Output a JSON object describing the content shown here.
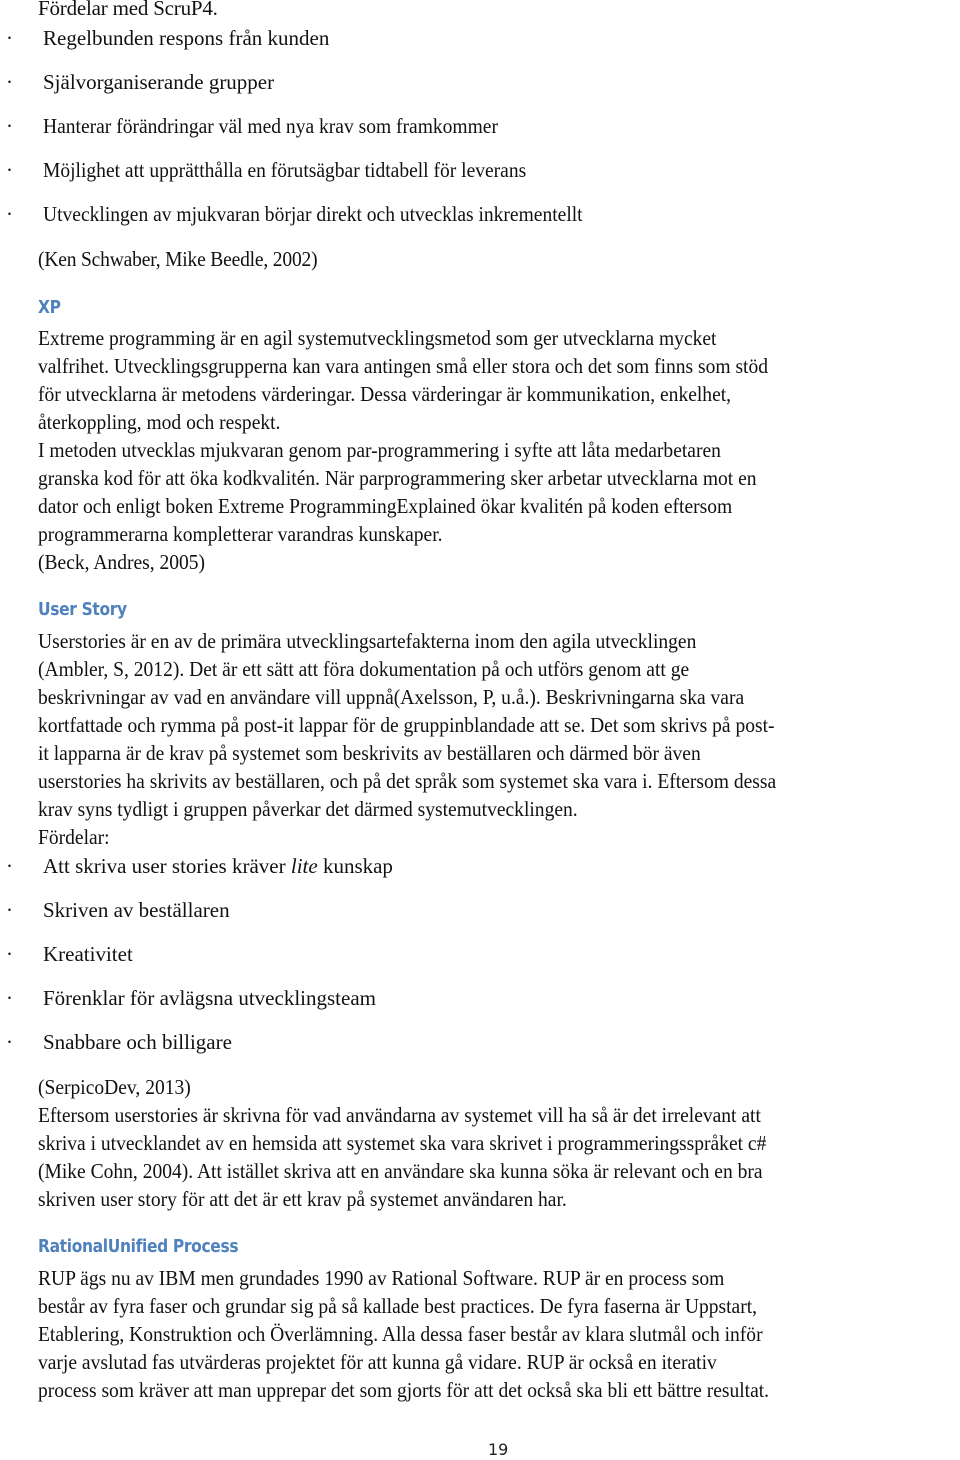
{
  "scrum_advantages": {
    "title": "Fördelar med ScruP4.",
    "bullet": "·",
    "items": [
      "Regelbunden respons från kunden",
      "Självorganiserande grupper",
      "Hanterar förändringar väl med nya krav som framkommer",
      "Möjlighet att upprätthålla en förutsägbar tidtabell för leverans",
      "Utvecklingen av mjukvaran börjar direkt och utvecklas inkrementellt"
    ],
    "citation": "(Ken Schwaber, Mike Beedle, 2002)"
  },
  "xp": {
    "heading": "XP",
    "paragraph1_lines": [
      "Extreme programming är en agil systemutvecklingsmetod som ger utvecklarna mycket",
      "valfrihet. Utvecklingsgrupperna kan vara antingen små eller stora och det som finns som stöd",
      "för utvecklarna är metodens värderingar. Dessa värderingar är kommunikation, enkelhet,",
      "återkoppling, mod och respekt."
    ],
    "paragraph2_lines": [
      "I metoden utvecklas mjukvaran genom par-programmering i syfte att låta medarbetaren",
      "granska kod för att öka kodkvalitén. När parprogrammering sker arbetar utvecklarna mot en",
      "dator och enligt boken Extreme ProgrammingExplained ökar kvalitén på koden eftersom",
      "programmerarna kompletterar varandras kunskaper."
    ],
    "citation": "(Beck, Andres, 2005)"
  },
  "user_story": {
    "heading": "User Story",
    "paragraph_lines": [
      "Userstories är en av de primära utvecklingsartefakterna inom den agila utvecklingen",
      "(Ambler, S, 2012). Det är ett sätt att föra dokumentation på och utförs genom att ge",
      "beskrivningar av vad en användare vill uppnå(Axelsson, P, u.å.). Beskrivningarna ska vara",
      "kortfattade och rymma på post-it lappar för de gruppinblandade att se. Det som skrivs på post-",
      "it lapparna är de krav på systemet som beskrivits av beställaren och därmed bör även",
      "userstories ha skrivits av beställaren, och på det språk som systemet ska vara i. Eftersom dessa",
      "krav syns tydligt i gruppen påverkar det därmed systemutvecklingen."
    ],
    "advantages_label": "Fördelar:",
    "advantages": [
      {
        "before": "Att skriva user stories kräver ",
        "italic": "lite",
        "after": " kunskap"
      },
      {
        "before": "Skriven av beställaren",
        "italic": "",
        "after": ""
      },
      {
        "before": "Kreativitet",
        "italic": "",
        "after": ""
      },
      {
        "before": "Förenklar för avlägsna utvecklingsteam",
        "italic": "",
        "after": ""
      },
      {
        "before": "Snabbare och billigare",
        "italic": "",
        "after": ""
      }
    ],
    "citation": "(SerpicoDev, 2013)",
    "paragraph2_lines": [
      "Eftersom userstories är skrivna för vad användarna av systemet vill ha så är det irrelevant att",
      "skriva i utvecklandet av en hemsida att systemet ska vara skrivet i programmeringsspråket c#",
      "(Mike Cohn, 2004). Att istället skriva att en användare ska kunna söka är relevant och en bra",
      "skriven user story för att det är ett krav på systemet användaren har."
    ]
  },
  "rup": {
    "heading": "RationalUnified Process",
    "paragraph_lines": [
      "RUP ägs nu av IBM men grundades 1990 av Rational Software. RUP är en process som",
      "består av fyra faser och grundar sig på så kallade best practices. De fyra faserna är Uppstart,",
      "Etablering, Konstruktion och Överlämning. Alla dessa faser består av klara slutmål och inför",
      "varje avslutad fas utvärderas projektet för att kunna gå vidare. RUP är också en iterativ",
      "process som kräver att man upprepar det som gjorts för att det också ska bli ett bättre resultat."
    ]
  },
  "footer": {
    "page_number": "19"
  },
  "colors": {
    "heading": "#4f81bd",
    "text": "#111111"
  }
}
